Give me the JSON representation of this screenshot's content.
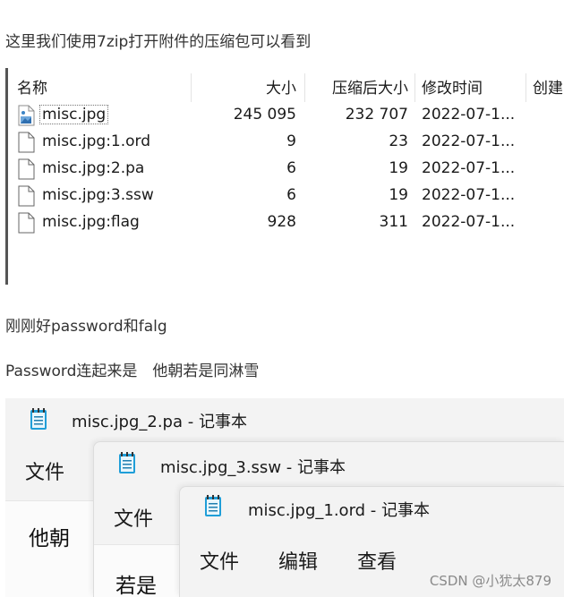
{
  "intro_text": "这里我们使用7zip打开附件的压缩包可以看到",
  "file_list": {
    "columns": {
      "name": "名称",
      "size": "大小",
      "packed": "压缩后大小",
      "modified": "修改时间",
      "created": "创建"
    },
    "rows": [
      {
        "name": "misc.jpg",
        "size": "245 095",
        "packed": "232 707",
        "modified": "2022-07-1...",
        "icon": "image-file-icon"
      },
      {
        "name": "misc.jpg:1.ord",
        "size": "9",
        "packed": "23",
        "modified": "2022-07-1...",
        "icon": "file-icon"
      },
      {
        "name": "misc.jpg:2.pa",
        "size": "6",
        "packed": "19",
        "modified": "2022-07-1...",
        "icon": "file-icon"
      },
      {
        "name": "misc.jpg:3.ssw",
        "size": "6",
        "packed": "19",
        "modified": "2022-07-1...",
        "icon": "file-icon"
      },
      {
        "name": "misc.jpg:flag",
        "size": "928",
        "packed": "311",
        "modified": "2022-07-1...",
        "icon": "file-icon"
      }
    ]
  },
  "text_2": "刚刚好password和falg",
  "text_3": "Password连起来是　他朝若是同淋雪",
  "notepads": [
    {
      "title": "misc.jpg_2.pa - 记事本",
      "menu": [
        "文件"
      ],
      "content": "他朝"
    },
    {
      "title": "misc.jpg_3.ssw - 记事本",
      "menu": [
        "文件"
      ],
      "content": "若是"
    },
    {
      "title": "misc.jpg_1.ord - 记事本",
      "menu": [
        "文件",
        "编辑",
        "查看"
      ]
    }
  ],
  "watermark": "CSDN @小犹太879"
}
